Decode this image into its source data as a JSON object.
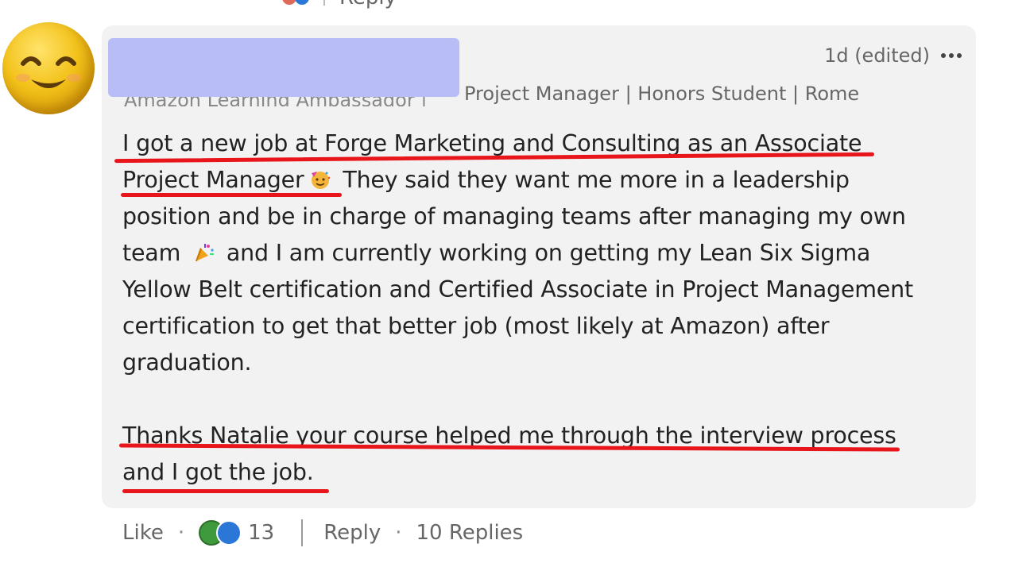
{
  "previous": {
    "reply_label": "Reply"
  },
  "comment": {
    "timestamp": "1d (edited)",
    "headline_visible": "Project Manager | Honors Student | Rome ...",
    "headline_ghost": "Amazon Learning Ambassador |",
    "paragraph1": [
      "I got a new job at Forge Marketing and Consulting as an Associate",
      "Project Manager",
      "They said they want me more in a leadership",
      "position and be in charge of managing teams after managing my own",
      "team",
      "and I am currently working on getting my Lean Six Sigma",
      "Yellow Belt certification and Certified Associate in Project Management",
      "certification to get that better job (most likely at Amazon) after",
      "graduation."
    ],
    "paragraph2": [
      "Thanks Natalie your course helped me through the interview process",
      "and I got the job."
    ]
  },
  "actions": {
    "like": "Like",
    "reaction_count": "13",
    "reply": "Reply",
    "replies": "10 Replies"
  },
  "colors": {
    "highlight_underline": "#e8161a",
    "redaction": "#b8bdf8",
    "bubble": "#f2f2f2"
  }
}
